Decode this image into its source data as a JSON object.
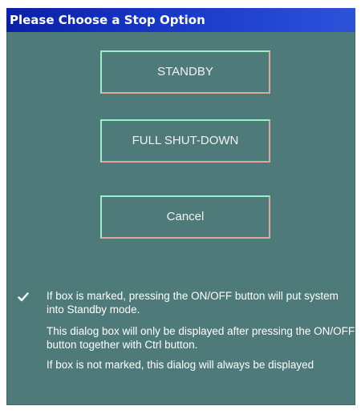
{
  "dialog": {
    "title": "Please Choose a Stop Option",
    "buttons": {
      "standby": "STANDBY",
      "full_shutdown": "FULL SHUT-DOWN",
      "cancel": "Cancel"
    },
    "checkbox": {
      "checked": true
    },
    "notes": [
      "If box is marked, pressing the ON/OFF button will put system into Standby mode.",
      "This dialog box will only be displayed after pressing the ON/OFF button together with Ctrl button.",
      "If box is not marked, this dialog will always be displayed"
    ]
  },
  "colors": {
    "dialog_background": "#4e7b79",
    "titlebar_start": "#0a1fa6",
    "titlebar_end": "#2d52da",
    "button_highlight": "#98f0c8",
    "button_shadow": "#d9a99e"
  }
}
